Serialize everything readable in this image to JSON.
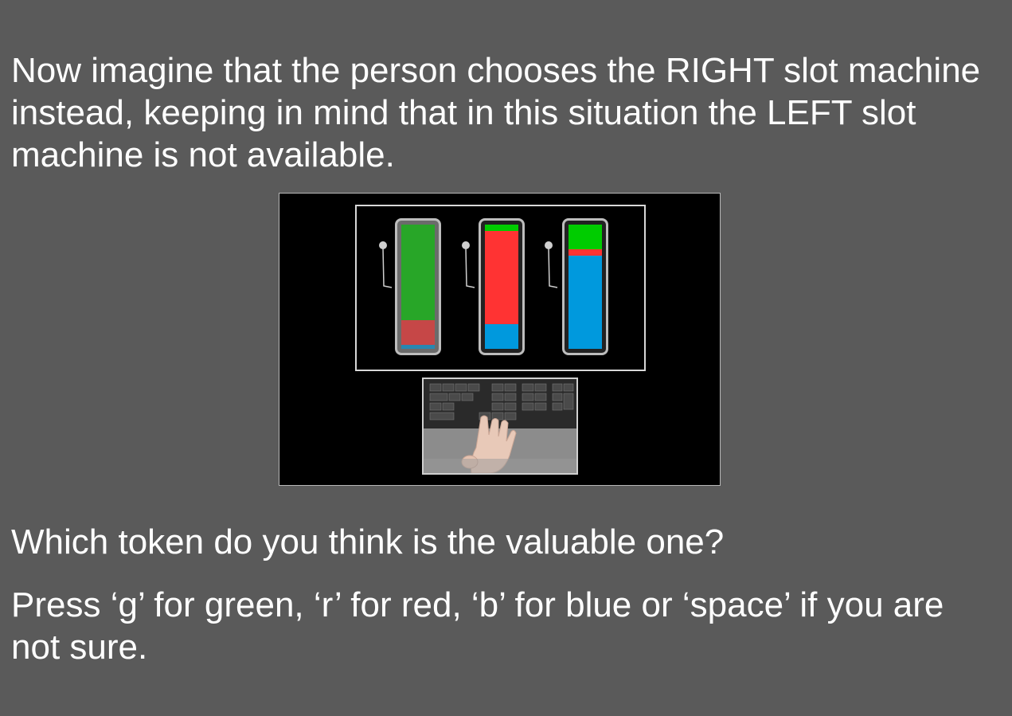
{
  "instruction": "Now imagine that the person chooses the RIGHT slot machine instead, keeping in mind that in this situation the LEFT slot machine is not available.",
  "question": "Which token do you think is the valuable one?",
  "press_instructions": "Press ‘g’ for green, ‘r’ for red, ‘b’ for blue or ‘space’ if you are not sure.",
  "colors": {
    "background": "#5a5a5a",
    "green": "#00cc00",
    "red": "#ff3333",
    "blue": "#0099dd",
    "text": "#ffffff"
  },
  "slot_machines": [
    {
      "position": "left",
      "available": false,
      "token_shares": [
        {
          "token": "green",
          "fraction": 0.77
        },
        {
          "token": "red",
          "fraction": 0.2
        },
        {
          "token": "blue",
          "fraction": 0.03
        }
      ]
    },
    {
      "position": "middle",
      "available": true,
      "token_shares": [
        {
          "token": "green",
          "fraction": 0.05
        },
        {
          "token": "red",
          "fraction": 0.75
        },
        {
          "token": "blue",
          "fraction": 0.2
        }
      ]
    },
    {
      "position": "right",
      "available": true,
      "token_shares": [
        {
          "token": "green",
          "fraction": 0.2
        },
        {
          "token": "red",
          "fraction": 0.05
        },
        {
          "token": "blue",
          "fraction": 0.75
        }
      ]
    }
  ],
  "keyboard_image": {
    "description_icon": "hand-on-keyboard-icon"
  }
}
